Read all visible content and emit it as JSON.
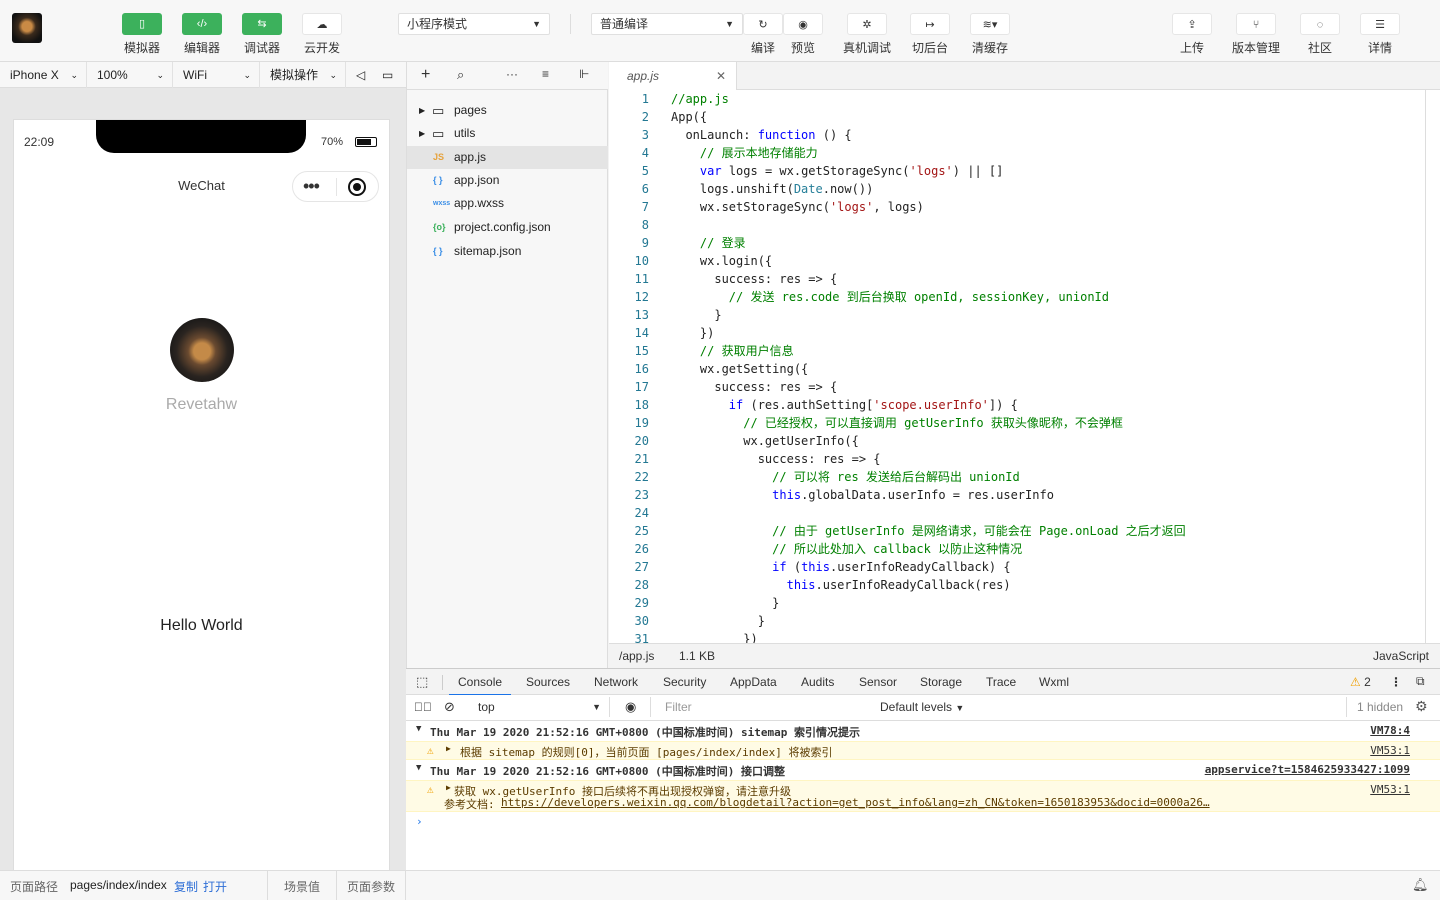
{
  "toolbar": {
    "simulator": "模拟器",
    "editor": "编辑器",
    "debugger": "调试器",
    "cloud": "云开发",
    "mode": "小程序模式",
    "compile_mode": "普通编译",
    "compile": "编译",
    "preview": "预览",
    "remote_debug": "真机调试",
    "background": "切后台",
    "clear_cache": "清缓存",
    "upload": "上传",
    "version": "版本管理",
    "community": "社区",
    "details": "详情"
  },
  "simbar": {
    "device": "iPhone X",
    "zoom": "100%",
    "network": "WiFi",
    "sim_ops": "模拟操作"
  },
  "phone": {
    "time": "22:09",
    "battery": "70%",
    "nav_title": "WeChat",
    "nickname": "Revetahw",
    "hello": "Hello World"
  },
  "footer": {
    "path_label": "页面路径",
    "path": "pages/index/index",
    "copy": "复制",
    "open": "打开",
    "scene": "场景值",
    "params": "页面参数"
  },
  "tree": [
    {
      "name": "pages",
      "icon": "folder-icon"
    },
    {
      "name": "utils",
      "icon": "folder-icon"
    },
    {
      "name": "app.js",
      "icon": "js-file-icon",
      "badge": "JS"
    },
    {
      "name": "app.json",
      "icon": "json-file-icon",
      "badge": "{ }"
    },
    {
      "name": "app.wxss",
      "icon": "wxss-file-icon",
      "badge": "wxss"
    },
    {
      "name": "project.config.json",
      "icon": "config-file-icon",
      "badge": "{o}"
    },
    {
      "name": "sitemap.json",
      "icon": "json-file-icon",
      "badge": "{ }"
    }
  ],
  "editor": {
    "tab": "app.js",
    "path": "/app.js",
    "size": "1.1 KB",
    "language": "JavaScript",
    "lines": [
      "//app.js",
      "App({",
      "  onLaunch: function () {",
      "    // 展示本地存储能力",
      "    var logs = wx.getStorageSync('logs') || []",
      "    logs.unshift(Date.now())",
      "    wx.setStorageSync('logs', logs)",
      "",
      "    // 登录",
      "    wx.login({",
      "      success: res => {",
      "        // 发送 res.code 到后台换取 openId, sessionKey, unionId",
      "      }",
      "    })",
      "    // 获取用户信息",
      "    wx.getSetting({",
      "      success: res => {",
      "        if (res.authSetting['scope.userInfo']) {",
      "          // 已经授权，可以直接调用 getUserInfo 获取头像昵称，不会弹框",
      "          wx.getUserInfo({",
      "            success: res => {",
      "              // 可以将 res 发送给后台解码出 unionId",
      "              this.globalData.userInfo = res.userInfo",
      "",
      "              // 由于 getUserInfo 是网络请求，可能会在 Page.onLoad 之后才返回",
      "              // 所以此处加入 callback 以防止这种情况",
      "              if (this.userInfoReadyCallback) {",
      "                this.userInfoReadyCallback(res)",
      "              }",
      "            }",
      "          })"
    ]
  },
  "devtools": {
    "tabs": [
      "Console",
      "Sources",
      "Network",
      "Security",
      "AppData",
      "Audits",
      "Sensor",
      "Storage",
      "Trace",
      "Wxml"
    ],
    "warn_count": "2",
    "context": "top",
    "filter_placeholder": "Filter",
    "levels": "Default levels",
    "hidden": "1 hidden",
    "group1": "Thu Mar 19 2020 21:52:16 GMT+0800 (中国标准时间) sitemap 索引情况提示",
    "group1_src": "VM78:4",
    "warn1": "根据 sitemap 的规则[0]，当前页面 [pages/index/index] 将被索引",
    "warn1_src": "VM53:1",
    "group2": "Thu Mar 19 2020 21:52:16 GMT+0800 (中国标准时间) 接口调整",
    "group2_src": "appservice?t=1584625933427:1099",
    "warn2": "获取 wx.getUserInfo 接口后续将不再出现授权弹窗，请注意升级",
    "warn2_src": "VM53:1",
    "warn2_doc_label": "参考文档:",
    "warn2_doc_url": "https://developers.weixin.qq.com/blogdetail?action=get_post_info&lang=zh_CN&token=1650183953&docid=0000a26…"
  }
}
